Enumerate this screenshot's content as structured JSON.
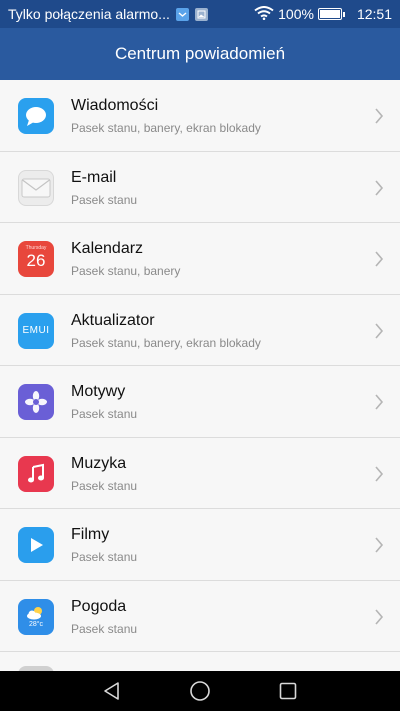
{
  "status_bar": {
    "carrier_text": "Tylko połączenia alarmo...",
    "battery": "100%",
    "time": "12:51"
  },
  "header": {
    "title": "Centrum powiadomień"
  },
  "apps": [
    {
      "name": "Wiadomości",
      "subtitle": "Pasek stanu, banery, ekran blokady",
      "icon": "messages-icon",
      "color": "#2aa0ee"
    },
    {
      "name": "E-mail",
      "subtitle": "Pasek stanu",
      "icon": "email-icon",
      "color": "#ececec"
    },
    {
      "name": "Kalendarz",
      "subtitle": "Pasek stanu, banery",
      "icon": "calendar-icon",
      "color": "#e8473c",
      "icon_label_top": "Thursday",
      "icon_label_day": "26"
    },
    {
      "name": "Aktualizator",
      "subtitle": "Pasek stanu, banery, ekran blokady",
      "icon": "updater-icon",
      "color": "#2aa0ee",
      "icon_label": "EMUI"
    },
    {
      "name": "Motywy",
      "subtitle": "Pasek stanu",
      "icon": "themes-icon",
      "color": "#6a5fd6"
    },
    {
      "name": "Muzyka",
      "subtitle": "Pasek stanu",
      "icon": "music-icon",
      "color": "#e8384f"
    },
    {
      "name": "Filmy",
      "subtitle": "Pasek stanu",
      "icon": "video-icon",
      "color": "#2a9eed"
    },
    {
      "name": "Pogoda",
      "subtitle": "Pasek stanu",
      "icon": "weather-icon",
      "color": "#2f8ee8",
      "icon_label": "28°c"
    }
  ]
}
